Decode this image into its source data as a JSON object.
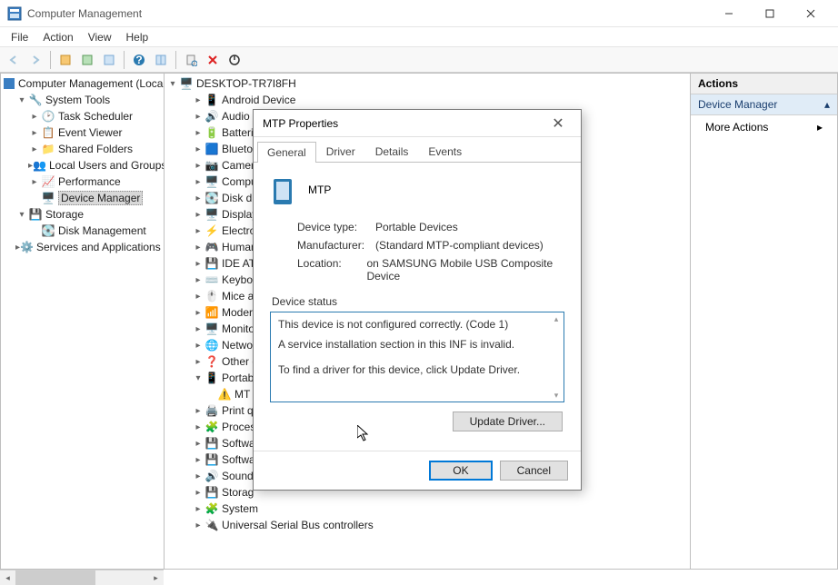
{
  "window": {
    "title": "Computer Management"
  },
  "menu": {
    "file": "File",
    "action": "Action",
    "view": "View",
    "help": "Help"
  },
  "left_tree": {
    "root": "Computer Management (Local)",
    "system_tools": "System Tools",
    "task_scheduler": "Task Scheduler",
    "event_viewer": "Event Viewer",
    "shared_folders": "Shared Folders",
    "local_users": "Local Users and Groups",
    "performance": "Performance",
    "device_manager": "Device Manager",
    "storage": "Storage",
    "disk_management": "Disk Management",
    "services_apps": "Services and Applications"
  },
  "center_tree": {
    "root": "DESKTOP-TR7I8FH",
    "items": [
      "Android Device",
      "Audio i",
      "Batteri",
      "Bluetoo",
      "Camera",
      "Compu",
      "Disk dr",
      "Display",
      "Electro",
      "Human",
      "IDE ATA",
      "Keyboa",
      "Mice a",
      "Moder",
      "Monito",
      "Netwo",
      "Other c",
      "Portab",
      "MT",
      "Print q",
      "Proces",
      "Softwa",
      "Softwa",
      "Sound,",
      "Storag",
      "System",
      "Universal Serial Bus controllers"
    ]
  },
  "actions": {
    "header": "Actions",
    "subhead": "Device Manager",
    "item1": "More Actions"
  },
  "dialog": {
    "title": "MTP Properties",
    "tabs": {
      "general": "General",
      "driver": "Driver",
      "details": "Details",
      "events": "Events"
    },
    "device_name": "MTP",
    "rows": {
      "type_lbl": "Device type:",
      "type_val": "Portable Devices",
      "mfr_lbl": "Manufacturer:",
      "mfr_val": "(Standard MTP-compliant devices)",
      "loc_lbl": "Location:",
      "loc_val": "on SAMSUNG Mobile USB Composite Device"
    },
    "status_legend": "Device status",
    "status_line1": "This device is not configured correctly. (Code 1)",
    "status_line2": "A service installation section in this INF is invalid.",
    "status_line3": "To find a driver for this device, click Update Driver.",
    "update_btn": "Update Driver...",
    "ok": "OK",
    "cancel": "Cancel"
  }
}
